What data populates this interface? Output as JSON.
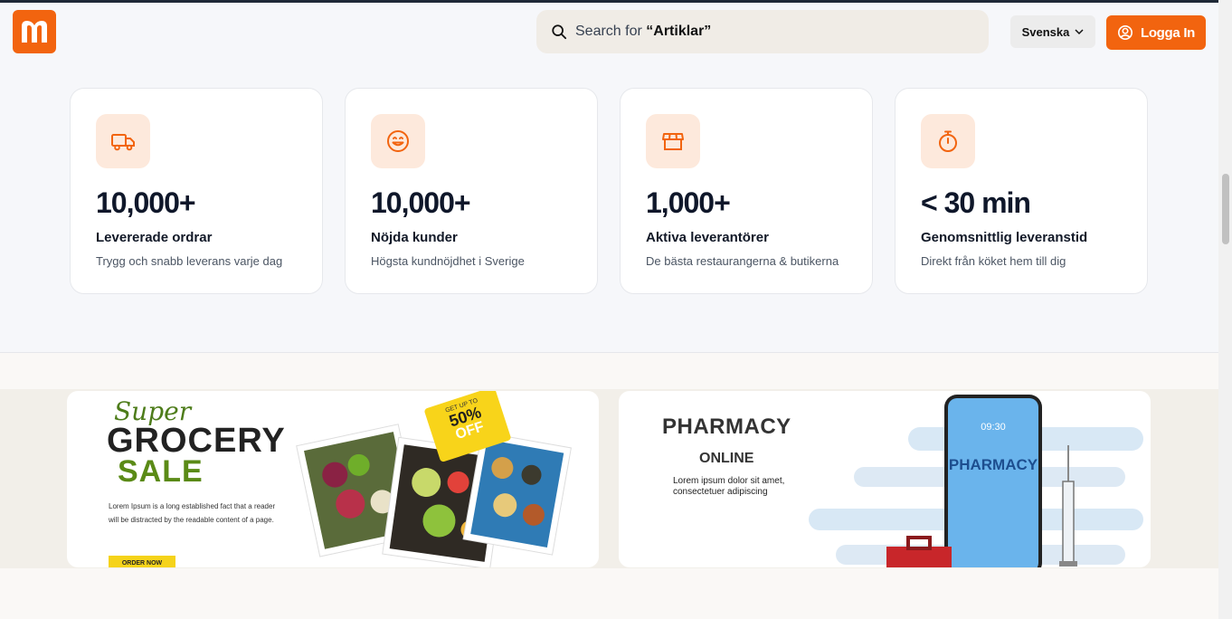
{
  "header": {
    "logo_letter": "m",
    "search": {
      "prefix": "Search for ",
      "term": "“Artiklar”",
      "icon": "search-icon"
    },
    "language": {
      "selected": "Svenska",
      "icon": "chevron-down-icon"
    },
    "login": {
      "label": "Logga In",
      "icon": "user-circle-icon"
    }
  },
  "stats": [
    {
      "icon": "truck-icon",
      "value": "10,000+",
      "title": "Levererade ordrar",
      "subtitle": "Trygg och snabb leverans varje dag"
    },
    {
      "icon": "smile-icon",
      "value": "10,000+",
      "title": "Nöjda kunder",
      "subtitle": "Högsta kundnöjdhet i Sverige"
    },
    {
      "icon": "store-icon",
      "value": "1,000+",
      "title": "Aktiva leverantörer",
      "subtitle": "De bästa restaurangerna & butikerna"
    },
    {
      "icon": "stopwatch-icon",
      "value": "< 30 min",
      "title": "Genomsnittlig leveranstid",
      "subtitle": "Direkt från köket hem till dig"
    }
  ],
  "banners": {
    "grocery": {
      "super": "Super",
      "grocery": "GROCERY",
      "sale": "SALE",
      "description": "Lorem Ipsum is a long established fact that a reader will be distracted by the readable content of a page.",
      "cta": "ORDER NOW",
      "badge_top": "GET UP TO",
      "badge_pct": "50%",
      "badge_off": "OFF"
    },
    "pharmacy": {
      "title": "PHARMACY",
      "subtitle": "ONLINE",
      "description": "Lorem ipsum dolor sit amet, consectetuer adipiscing",
      "phone_time": "09:30",
      "phone_title": "PHARMACY"
    }
  },
  "colors": {
    "accent": "#f2640f",
    "icon_bg": "#fde9dc"
  }
}
